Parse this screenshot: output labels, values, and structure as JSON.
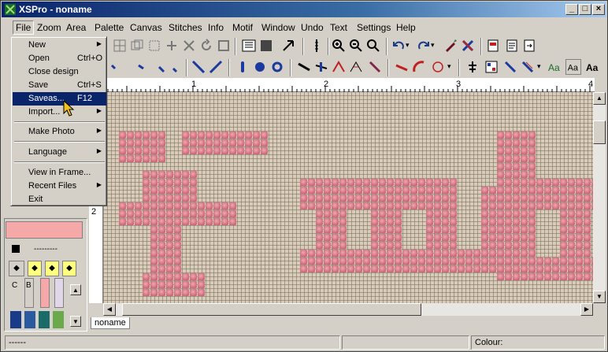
{
  "window": {
    "title": "XSPro - noname",
    "min": "_",
    "max": "□",
    "close": "×"
  },
  "menu": {
    "file": "File",
    "zoom": "Zoom",
    "area": "Area",
    "palette": "Palette",
    "canvas": "Canvas",
    "stitches": "Stitches",
    "info": "Info",
    "motif": "Motif",
    "window": "Window",
    "undo": "Undo",
    "text": "Text",
    "settings": "Settings",
    "help": "Help"
  },
  "file_menu": {
    "items": [
      {
        "label": "New",
        "shortcut": "",
        "submenu": true
      },
      {
        "label": "Open",
        "shortcut": "Ctrl+O",
        "submenu": false
      },
      {
        "label": "Close design",
        "shortcut": "",
        "submenu": false
      },
      {
        "label": "Save",
        "shortcut": "Ctrl+S",
        "submenu": false
      },
      {
        "label": "Saveas...",
        "shortcut": "F12",
        "submenu": false
      },
      {
        "label": "Import...",
        "shortcut": "",
        "submenu": true
      },
      {
        "label": "Make Photo",
        "shortcut": "",
        "submenu": true
      },
      {
        "label": "Language",
        "shortcut": "",
        "submenu": true
      },
      {
        "label": "View in Frame...",
        "shortcut": "",
        "submenu": false
      },
      {
        "label": "Recent Files",
        "shortcut": "",
        "submenu": true
      },
      {
        "label": "Exit",
        "shortcut": "",
        "submenu": false
      }
    ]
  },
  "ruler": {
    "marks": [
      "1",
      "2",
      "3",
      "4"
    ],
    "vmark": "2"
  },
  "tabs": {
    "doc": "noname"
  },
  "status": {
    "left": "------",
    "colour_label": "Colour:"
  },
  "left_panel": {
    "line_text": "---------",
    "col_c": "C",
    "col_b": "B"
  },
  "colors": {
    "accent": "#0a246a",
    "pink": "#d57686",
    "canvas": "#d8cbb8",
    "swatch": "#f4a9a8"
  },
  "icons": {
    "arrow_submenu": "▶",
    "chev_down": "▾",
    "scroll_up": "▲",
    "scroll_down": "▼",
    "scroll_left": "◀",
    "scroll_right": "▶"
  }
}
